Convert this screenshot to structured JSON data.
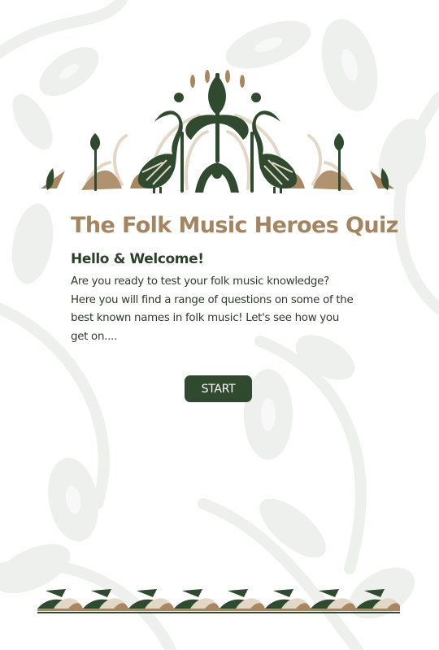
{
  "quiz": {
    "title": "The Folk Music Heroes Quiz",
    "greeting": "Hello & Welcome!",
    "intro": "Are you ready to test your folk music knowledge? Here you will find a range of questions on some of the best known names in folk music! Let's see how you get on....",
    "start_label": "START"
  },
  "colors": {
    "title": "#a48560",
    "dark_green": "#2f4a2e",
    "tan": "#a98660",
    "cream": "#e3d7c6",
    "background_pattern": "#eef0ed"
  },
  "icons": {
    "header": "folk-birds-and-flowers-ornament",
    "footer": "folk-leaf-border-ornament"
  }
}
